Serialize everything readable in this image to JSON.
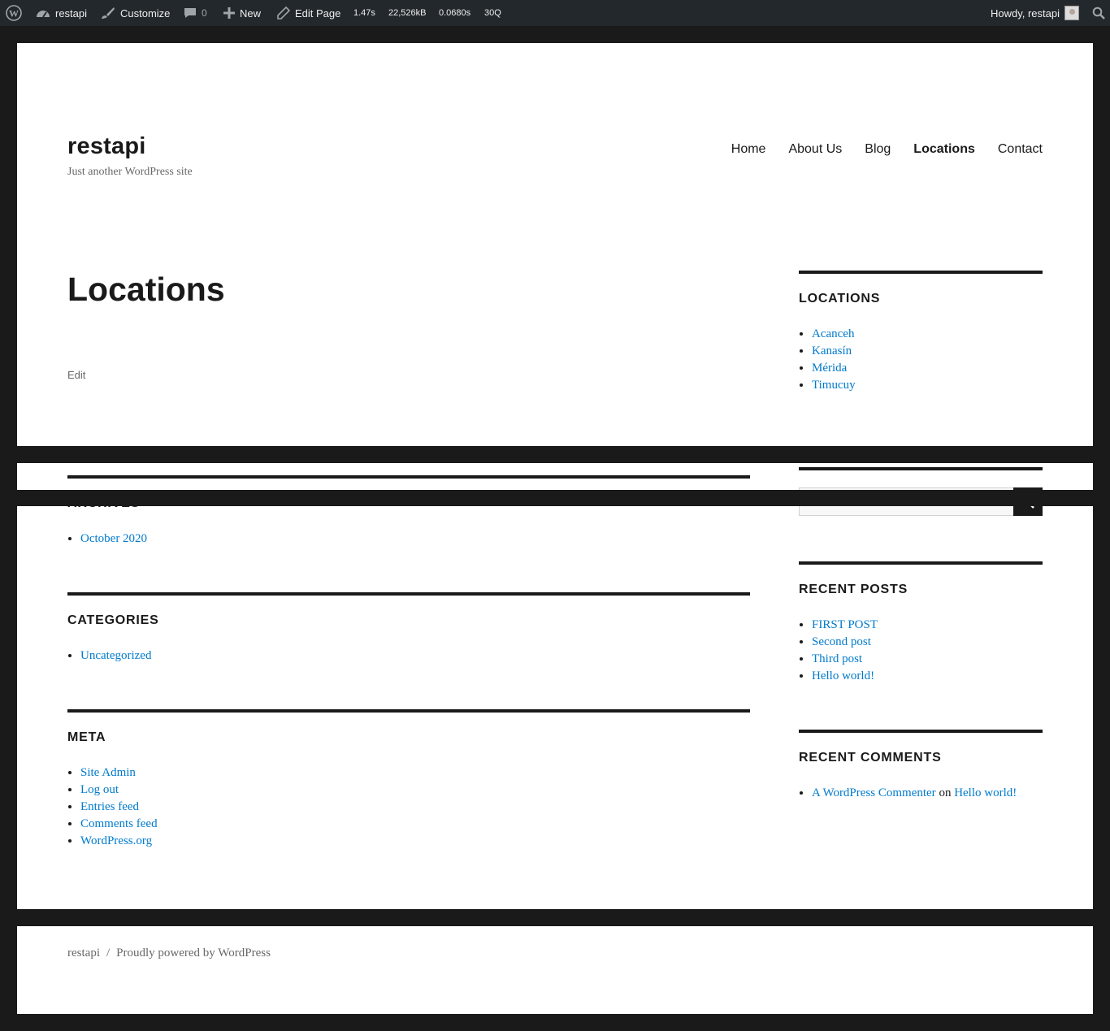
{
  "admin_bar": {
    "site_name": "restapi",
    "customize": "Customize",
    "comments_count": "0",
    "new": "New",
    "edit_page": "Edit Page",
    "stats": [
      "1.47s",
      "22,526kB",
      "0.0680s",
      "30Q"
    ],
    "howdy": "Howdy, restapi"
  },
  "header": {
    "site_title": "restapi",
    "site_description": "Just another WordPress site",
    "nav": [
      "Home",
      "About Us",
      "Blog",
      "Locations",
      "Contact"
    ]
  },
  "main": {
    "heading": "Locations",
    "edit": "Edit"
  },
  "sidebar_right": {
    "locations": {
      "title": "LOCATIONS",
      "items": [
        "Acanceh",
        "Kanasín",
        "Mérida",
        "Timucuy"
      ]
    },
    "recent_posts": {
      "title": "RECENT POSTS",
      "items": [
        "FIRST POST",
        "Second post",
        "Third post",
        "Hello world!"
      ]
    },
    "recent_comments": {
      "title": "RECENT COMMENTS",
      "author": "A WordPress Commenter",
      "on": "on",
      "post": "Hello world!"
    }
  },
  "widgets_left": {
    "archives": {
      "title": "ARCHIVES",
      "items": [
        "October 2020"
      ]
    },
    "categories": {
      "title": "CATEGORIES",
      "items": [
        "Uncategorized"
      ]
    },
    "meta": {
      "title": "META",
      "items": [
        "Site Admin",
        "Log out",
        "Entries feed",
        "Comments feed",
        "WordPress.org"
      ]
    }
  },
  "footer": {
    "site": "restapi",
    "separator": "/",
    "powered": "Proudly powered by WordPress"
  },
  "colors": {
    "link": "#007acc",
    "dark": "#1a1a1a",
    "adminbar": "#23282d"
  }
}
